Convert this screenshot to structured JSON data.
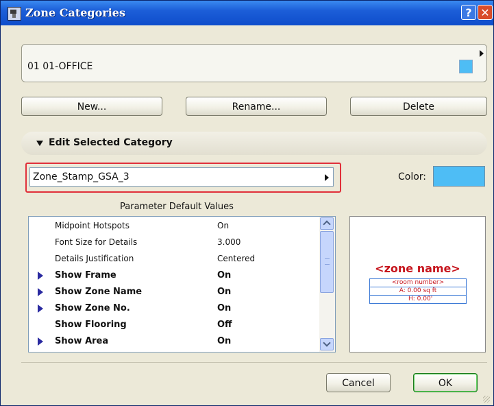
{
  "window": {
    "title": "Zone Categories",
    "help_glyph": "?",
    "close_glyph": "✕"
  },
  "category": {
    "current": "01  01-OFFICE",
    "swatch_color": "#4ebdf5"
  },
  "buttons": {
    "new": "New...",
    "rename": "Rename...",
    "delete": "Delete"
  },
  "edit_section": {
    "title": "Edit Selected Category",
    "stamp": "Zone_Stamp_GSA_3",
    "color_label": "Color:",
    "color_value": "#4ebdf5"
  },
  "params": {
    "title": "Parameter Default Values",
    "rows": [
      {
        "name": "Midpoint Hotspots",
        "value": "On"
      },
      {
        "name": "Font Size for Details",
        "value": "3.000"
      },
      {
        "name": "Details Justification",
        "value": "Centered"
      },
      {
        "name": "Show Frame",
        "value": "On"
      },
      {
        "name": "Show Zone Name",
        "value": "On"
      },
      {
        "name": "Show Zone No.",
        "value": "On"
      },
      {
        "name": "Show Flooring",
        "value": "Off"
      },
      {
        "name": "Show Area",
        "value": "On"
      }
    ]
  },
  "preview": {
    "zone_name": "<zone name>",
    "room_number": "<room number>",
    "area": "A: 0.00 sq ft",
    "height": "H: 0.00'"
  },
  "dialog": {
    "cancel": "Cancel",
    "ok": "OK"
  }
}
